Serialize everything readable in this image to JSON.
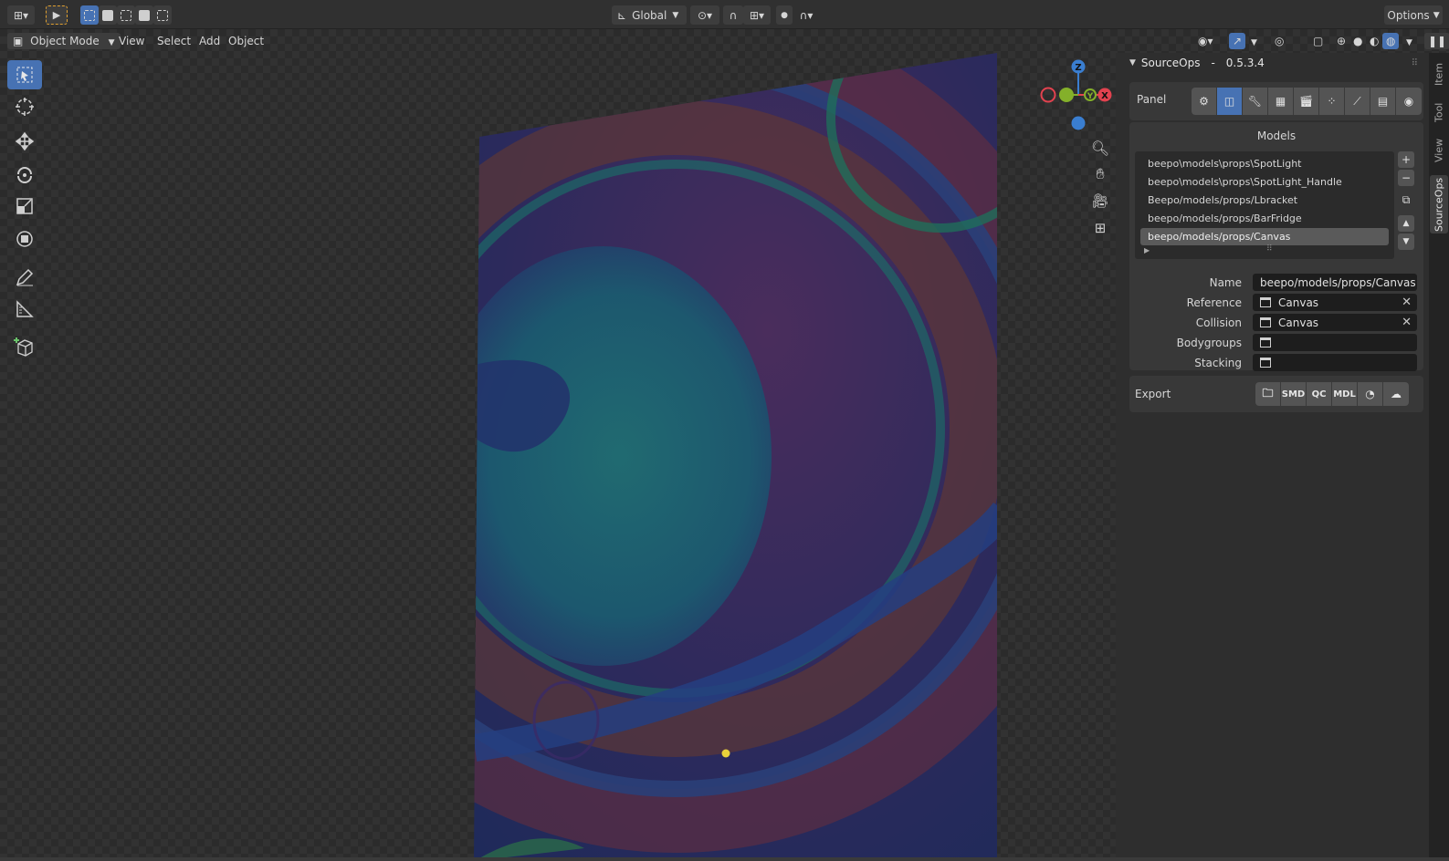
{
  "header": {
    "orientation_label": "Global",
    "options_label": "Options"
  },
  "menubar": {
    "mode_label": "Object Mode",
    "items": [
      "View",
      "Select",
      "Add",
      "Object"
    ]
  },
  "gizmo": {
    "z": "Z",
    "y": "Y",
    "x": "X"
  },
  "sidebar": {
    "tabs": [
      "Item",
      "Tool",
      "View",
      "SourceOps"
    ],
    "active_tab": "SourceOps",
    "panel_title": "SourceOps",
    "panel_sep": "-",
    "panel_version": "0.5.3.4",
    "panel_label": "Panel",
    "models_title": "Models",
    "models": [
      "beepo\\models\\props\\SpotLight",
      "beepo\\models\\props\\SpotLight_Handle",
      "Beepo/models/props/Lbracket",
      "beepo/models/props/BarFridge",
      "beepo/models/props/Canvas"
    ],
    "selected_model_index": 4,
    "props": {
      "name_label": "Name",
      "name_value": "beepo/models/props/Canvas",
      "reference_label": "Reference",
      "reference_value": "Canvas",
      "collision_label": "Collision",
      "collision_value": "Canvas",
      "bodygroups_label": "Bodygroups",
      "bodygroups_value": "",
      "stacking_label": "Stacking",
      "stacking_value": ""
    },
    "export_label": "Export",
    "export_buttons": [
      "SMD",
      "QC",
      "MDL"
    ]
  },
  "colors": {
    "accent": "#4772b3",
    "axis_x": "#e2424f",
    "axis_y": "#84b02a",
    "axis_z": "#3a7ed0",
    "origin_dot": "#e8d23a"
  }
}
